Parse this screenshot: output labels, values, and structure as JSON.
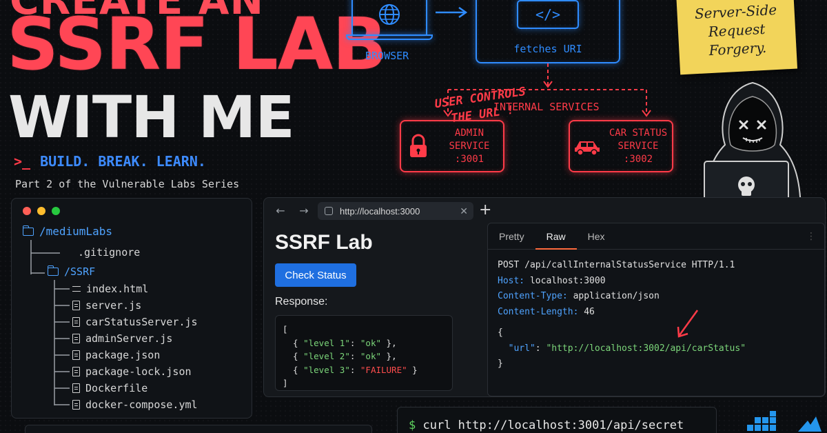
{
  "title": {
    "line1": "CREATE AN",
    "line2": "SSRF LAB",
    "line3": "WITH ME",
    "tagline_prompt": ">_",
    "tagline": "BUILD. BREAK. LEARN.",
    "series": "Part 2 of the Vulnerable Labs Series"
  },
  "diagram": {
    "browser_label": "BROWSER",
    "code_glyph": "</>",
    "fetch_label": "fetches URI",
    "internal_label": "INTERNAL SERVICES",
    "admin_service": [
      "ADMIN",
      "SERVICE",
      ":3001"
    ],
    "car_service": [
      "CAR STATUS",
      "SERVICE",
      ":3002"
    ],
    "colors": {
      "blue": "#2f8cff",
      "red": "#ff3b48"
    }
  },
  "sticky_note": [
    "Server-Side",
    "Request",
    "Forgery."
  ],
  "file_tree": {
    "root": "/mediumLabs",
    "gitignore": ".gitignore",
    "folder": "/SSRF",
    "files": [
      "index.html",
      "server.js",
      "carStatusServer.js",
      "adminServer.js",
      "package.json",
      "package-lock.json",
      "Dockerfile",
      "docker-compose.yml"
    ]
  },
  "browser": {
    "url": "http://localhost:3000",
    "page_title": "SSRF Lab",
    "button": "Check Status",
    "response_label": "Response:",
    "response": {
      "open": "[",
      "items": [
        {
          "key": "\"level 1\"",
          "value": "\"ok\""
        },
        {
          "key": "\"level 2\"",
          "value": "\"ok\""
        },
        {
          "key": "\"level 3\"",
          "value": "\"FAILURE\""
        }
      ],
      "close": "]"
    }
  },
  "request": {
    "tabs": [
      "Pretty",
      "Raw",
      "Hex"
    ],
    "active_tab": "Raw",
    "request_line": "POST /api/callInternalStatusService HTTP/1.1",
    "headers": [
      {
        "name": "Host:",
        "value": "localhost:3000"
      },
      {
        "name": "Content-Type:",
        "value": "application/json"
      },
      {
        "name": "Content-Length:",
        "value": "46"
      }
    ],
    "body_open": "{",
    "body_key": "\"url\"",
    "body_value": "\"http://localhost:3002/api/carStatus\"",
    "body_close": "}",
    "annotation": [
      "USER CONTROLS",
      "THE URL !"
    ]
  },
  "terminal": {
    "prompt": "$",
    "command": "curl http://localhost:3001/api/secret"
  }
}
